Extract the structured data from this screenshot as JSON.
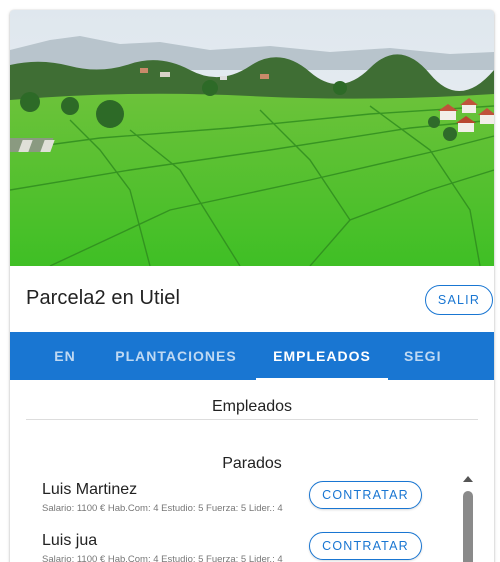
{
  "header": {
    "title": "Parcela2 en Utiel",
    "exit_label": "SALIR"
  },
  "hero": {
    "description_icon": "rice-field-image"
  },
  "tabs": [
    {
      "label": "EN",
      "active": false
    },
    {
      "label": "PLANTACIONES",
      "active": false
    },
    {
      "label": "EMPLEADOS",
      "active": true
    },
    {
      "label": "SEGI",
      "active": false
    }
  ],
  "main": {
    "section_title": "Empleados",
    "group_title": "Parados",
    "employees": [
      {
        "name": "Luis Martinez",
        "stats": "Salario: 1100 € Hab.Com: 4 Estudio: 5 Fuerza: 5 Lider.: 4",
        "action_label": "CONTRATAR"
      },
      {
        "name": "Luis jua",
        "stats": "Salario: 1100 € Hab.Com: 4 Estudio: 5 Fuerza: 5 Lider.: 4",
        "action_label": "CONTRATAR"
      }
    ]
  },
  "colors": {
    "primary": "#1976d2",
    "field_green": "#43c52a",
    "sky": "#e6edf2"
  }
}
